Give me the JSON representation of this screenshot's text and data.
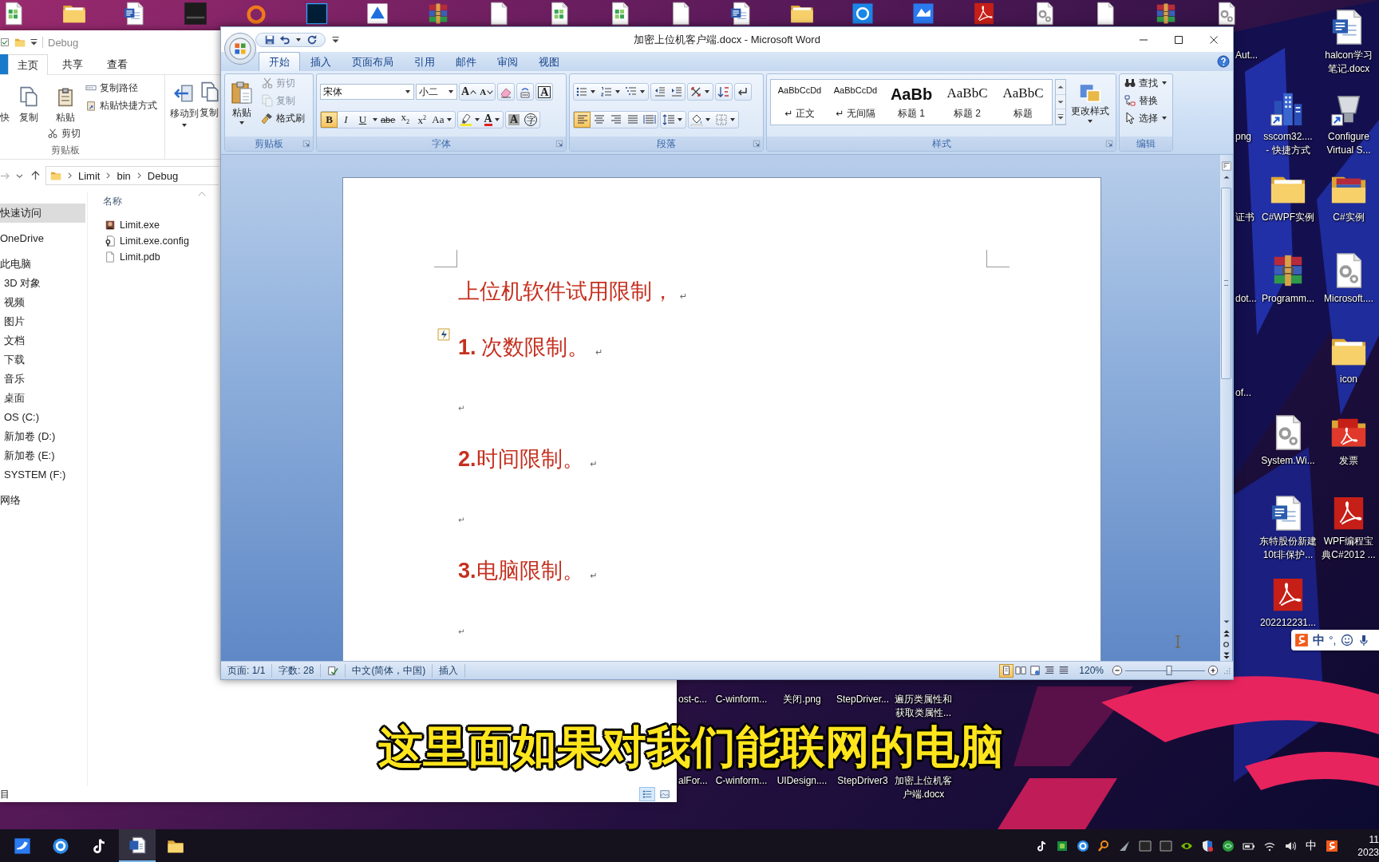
{
  "desktop": {
    "right_icons": [
      {
        "label": "halcon学习笔记.docx",
        "kind": "docx"
      },
      {
        "label": "sscom32....\n- 快捷方式",
        "kind": "building"
      },
      {
        "label": "Configure\nVirtual S...",
        "kind": "plug"
      },
      {
        "label": "C#WPF实例",
        "kind": "folder"
      },
      {
        "label": "C#实例",
        "kind": "afolder"
      },
      {
        "label": "Programm...",
        "kind": "archive"
      },
      {
        "label": "Microsoft....",
        "kind": "gear"
      },
      {
        "label": "icon",
        "kind": "folder"
      },
      {
        "label": "System.Wi...",
        "kind": "gear"
      },
      {
        "label": "发票",
        "kind": "pfolder"
      },
      {
        "label": "东特股份新建10t非保护...",
        "kind": "docx"
      },
      {
        "label": "WPF编程宝典C#2012 ...",
        "kind": "pdf"
      },
      {
        "label": "202212231...",
        "kind": "pdf"
      }
    ],
    "partial_labels": [
      "Aut...",
      "png",
      "证书",
      "dot...",
      "of..."
    ],
    "bottom_labels": [
      "ost-c...",
      "C-winform...",
      "关闭.png",
      "StepDriver...",
      "遍历类属性和获取类属性...",
      "alFor...",
      "C-winform...",
      "UIDesign....",
      "StepDriver3",
      "加密上位机客户端.docx"
    ],
    "ime": {
      "mode": "中",
      "punctuation": "°,"
    }
  },
  "subtitle": "这里面如果对我们能联网的电脑",
  "explorer": {
    "title": "Debug",
    "tabs": [
      {
        "label": "主页",
        "selected": true
      },
      {
        "label": "共享",
        "selected": false
      },
      {
        "label": "查看",
        "selected": false
      }
    ],
    "ribbon": {
      "pin": "快",
      "copy": "复制",
      "paste": "粘贴",
      "copy_path": "复制路径",
      "paste_shortcut": "粘贴快捷方式",
      "cut": "剪切",
      "group": "剪贴板",
      "move_to": "移动到",
      "copy_to": "复制"
    },
    "path": [
      "Limit",
      "bin",
      "Debug"
    ],
    "nav": [
      {
        "label": "快速访问",
        "selected": true
      },
      {
        "label": "OneDrive",
        "selected": false
      },
      {
        "label": "此电脑",
        "selected": false,
        "children": [
          {
            "label": "3D 对象",
            "selected": false
          },
          {
            "label": "视频",
            "selected": false
          },
          {
            "label": "图片",
            "selected": false
          },
          {
            "label": "文档",
            "selected": false
          },
          {
            "label": "下载",
            "selected": false
          },
          {
            "label": "音乐",
            "selected": false
          },
          {
            "label": "桌面",
            "selected": false
          },
          {
            "label": "OS (C:)",
            "selected": false
          },
          {
            "label": "新加卷 (D:)",
            "selected": false
          },
          {
            "label": "新加卷 (E:)",
            "selected": false
          },
          {
            "label": "SYSTEM (F:)",
            "selected": false
          }
        ]
      },
      {
        "label": "网络",
        "selected": false
      }
    ],
    "column": "名称",
    "files": [
      {
        "name": "Limit.exe",
        "kind": "exe"
      },
      {
        "name": "Limit.exe.config",
        "kind": "cfg"
      },
      {
        "name": "Limit.pdb",
        "kind": "file"
      }
    ],
    "status": "目",
    "views": [
      {
        "selected": true
      },
      {
        "selected": false
      }
    ]
  },
  "word": {
    "title": "加密上位机客户端.docx - Microsoft Word",
    "tabs": [
      {
        "label": "开始",
        "selected": true
      },
      {
        "label": "插入",
        "selected": false
      },
      {
        "label": "页面布局",
        "selected": false
      },
      {
        "label": "引用",
        "selected": false
      },
      {
        "label": "邮件",
        "selected": false
      },
      {
        "label": "审阅",
        "selected": false
      },
      {
        "label": "视图",
        "selected": false
      }
    ],
    "clipboard": {
      "paste": "粘贴",
      "items": [
        {
          "label": "剪切",
          "kind": "cut",
          "disabled": true
        },
        {
          "label": "复制",
          "kind": "copy",
          "disabled": true
        },
        {
          "label": "格式刷",
          "kind": "painter",
          "disabled": false
        }
      ],
      "group": "剪贴板"
    },
    "font": {
      "face": "宋体",
      "size": "小二",
      "grow": "A",
      "shrink": "A",
      "border": "A",
      "formats": [
        {
          "label": "B",
          "kind": "bold",
          "selected": true
        },
        {
          "label": "I",
          "kind": "italic",
          "selected": false
        },
        {
          "label": "U",
          "kind": "underline",
          "selected": false
        },
        {
          "label": "abe",
          "kind": "strike",
          "selected": false
        },
        {
          "label": "x$_{2}$",
          "kind": "subscript",
          "selected": false
        },
        {
          "label": "x$^{2}$",
          "kind": "superscript",
          "selected": false
        }
      ],
      "case": "Aa",
      "tint": "A",
      "shading": "A",
      "enclose": "字",
      "group": "字体"
    },
    "paragraph": {
      "alignment": [
        {
          "selected": true
        },
        {
          "selected": false
        },
        {
          "selected": false
        },
        {
          "selected": false
        },
        {
          "selected": false
        }
      ],
      "group": "段落"
    },
    "styles": {
      "items": [
        {
          "sample": "AaBbCcDd",
          "name": "↵ 正文",
          "kind": "body"
        },
        {
          "sample": "AaBbCcDd",
          "name": "↵ 无间隔",
          "kind": "body"
        },
        {
          "sample": "AaBb",
          "name": "标题 1",
          "kind": "heading1"
        },
        {
          "sample": "AaBbC",
          "name": "标题 2",
          "kind": "heading2"
        },
        {
          "sample": "AaBbC",
          "name": "标题",
          "kind": "title"
        }
      ],
      "change": "更改样式",
      "group": "样式"
    },
    "editing": {
      "items": [
        {
          "label": "查找",
          "kind": "find",
          "dropdown": true
        },
        {
          "label": "替换",
          "kind": "replace",
          "dropdown": false
        },
        {
          "label": "选择",
          "kind": "select",
          "dropdown": true
        }
      ],
      "group": "编辑"
    },
    "document": {
      "paragraphs": [
        {
          "text": "上位机软件试用限制，",
          "mark": "↵"
        },
        {
          "text": "**1.** 次数限制。",
          "mark": "↵"
        },
        {
          "mark": "↵"
        },
        {
          "text": "**2.**时间限制。",
          "mark": "↵"
        },
        {
          "mark": "↵"
        },
        {
          "text": "**3.**电脑限制。",
          "mark": "↵"
        },
        {
          "mark": "↵"
        }
      ]
    },
    "status": {
      "page": "页面: 1/1",
      "words": "字数: 28",
      "language": "中文(简体，中国)",
      "mode": "插入",
      "views": [
        {
          "selected": true
        },
        {
          "selected": false
        },
        {
          "selected": false
        },
        {
          "selected": false
        },
        {
          "selected": false
        }
      ],
      "zoom": "120%",
      "zoom_slider": {
        "level": 0.55
      }
    }
  },
  "taskbar": {
    "apps": [
      {
        "selected": false
      },
      {
        "selected": false
      },
      {
        "selected": false
      },
      {
        "selected": true
      },
      {
        "selected": false
      }
    ],
    "ime": "中",
    "time": "11",
    "date": "2023"
  }
}
